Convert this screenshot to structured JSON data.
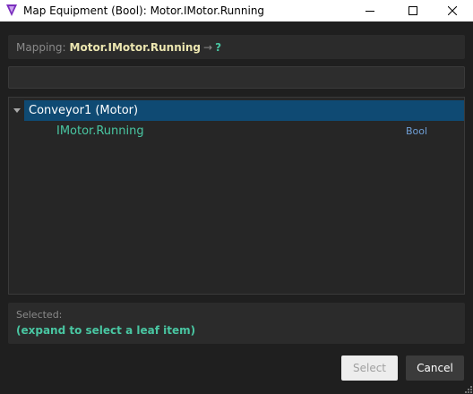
{
  "window": {
    "title": "Map Equipment (Bool): Motor.IMotor.Running",
    "icons": [
      "app-logo-icon",
      "minimize-icon",
      "maximize-icon",
      "close-icon"
    ]
  },
  "mapping": {
    "label": "Mapping:",
    "path": "Motor.IMotor.Running",
    "arrow": "→",
    "target": "?"
  },
  "search": {
    "value": "",
    "placeholder": ""
  },
  "tree": {
    "parent": {
      "label": "Conveyor1 (Motor)",
      "expanded": true
    },
    "children": [
      {
        "name": "IMotor.Running",
        "type": "Bool"
      }
    ]
  },
  "selected": {
    "label": "Selected:",
    "value": "(expand to select a leaf item)"
  },
  "buttons": {
    "select": "Select",
    "cancel": "Cancel"
  },
  "colors": {
    "accent_teal": "#49c6a2",
    "highlight_row": "#0f4a73",
    "path_yellow": "#ece6b0",
    "type_blue": "#6f9fd6",
    "app_icon_purple": "#7b2fbe"
  }
}
